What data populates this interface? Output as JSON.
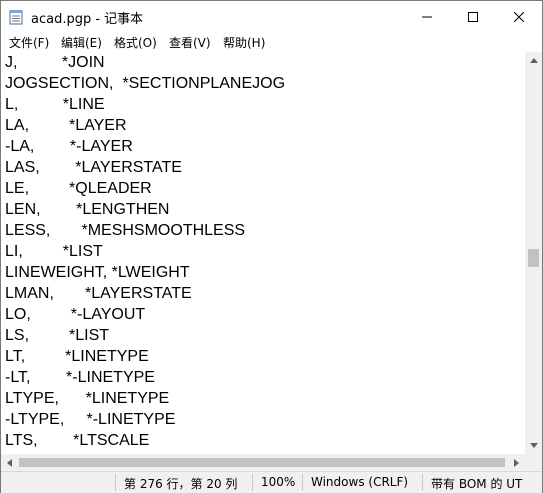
{
  "titlebar": {
    "title": "acad.pgp - 记事本",
    "minimize_icon": "minimize-icon",
    "maximize_icon": "maximize-icon",
    "close_icon": "close-icon"
  },
  "menu": [
    {
      "label": "文件(F)"
    },
    {
      "label": "编辑(E)"
    },
    {
      "label": "格式(O)"
    },
    {
      "label": "查看(V)"
    },
    {
      "label": "帮助(H)"
    }
  ],
  "editor": {
    "lines": [
      "J,          *JOIN",
      "JOGSECTION,  *SECTIONPLANEJOG",
      "L,          *LINE",
      "LA,         *LAYER",
      "-LA,        *-LAYER",
      "LAS,        *LAYERSTATE",
      "LE,         *QLEADER",
      "LEN,        *LENGTHEN",
      "LESS,       *MESHSMOOTHLESS",
      "LI,         *LIST",
      "LINEWEIGHT, *LWEIGHT",
      "LMAN,       *LAYERSTATE",
      "LO,         *-LAYOUT",
      "LS,         *LIST",
      "LT,         *LINETYPE",
      "-LT,        *-LINETYPE",
      "LTYPE,      *LINETYPE",
      "-LTYPE,     *-LINETYPE",
      "LTS,        *LTSCALE"
    ]
  },
  "statusbar": {
    "position": "第 276 行，第 20 列",
    "zoom": "100%",
    "line_ending": "Windows (CRLF)",
    "encoding": "带有 BOM 的 UT"
  }
}
